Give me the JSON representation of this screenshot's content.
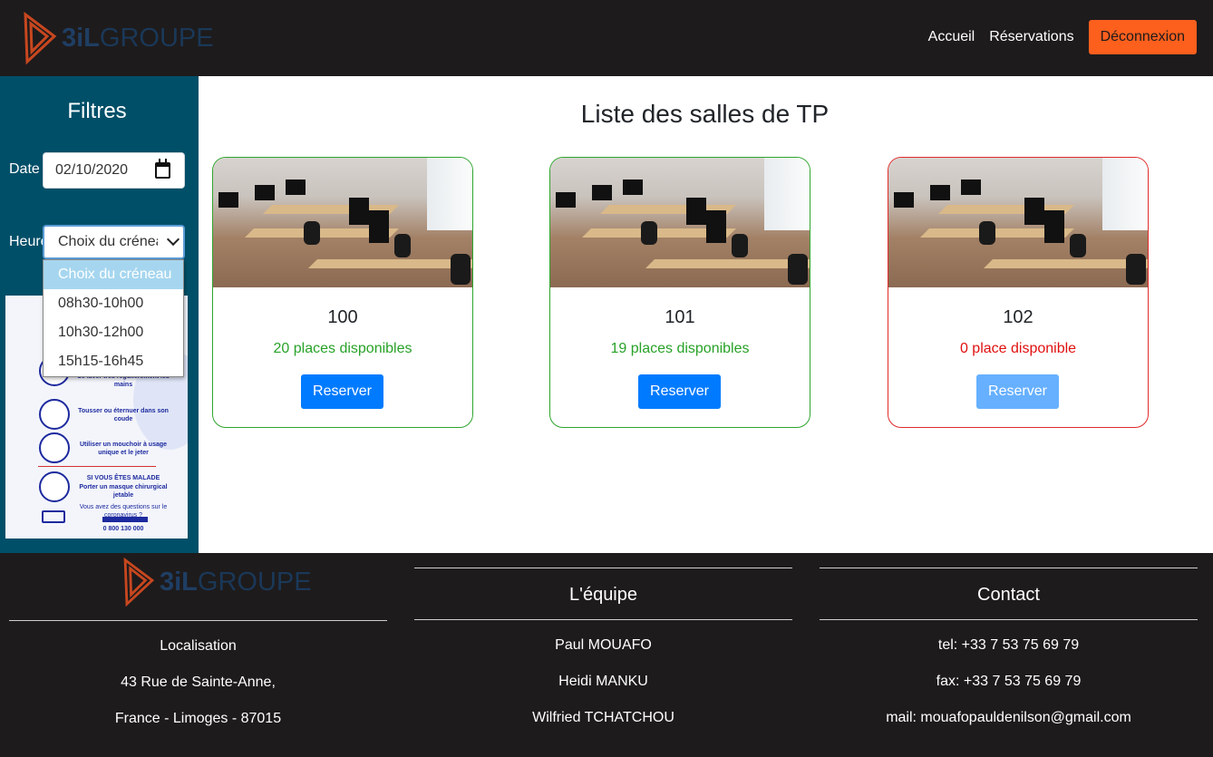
{
  "header": {
    "logo_brand": "3iL",
    "logo_group": "GROUPE",
    "nav": [
      "Accueil",
      "Réservations"
    ],
    "logout_label": "Déconnexion"
  },
  "sidebar": {
    "title": "Filtres",
    "date_label": "Date",
    "date_value": "02/10/2020",
    "time_label": "Heure",
    "select_value": "Choix du créneau",
    "options": [
      "Choix du créneau",
      "08h30-10h00",
      "10h30-12h00",
      "15h15-16h45"
    ],
    "poster_lines": [
      "Se laver très régulièrement les mains",
      "Tousser ou éternuer dans son coude",
      "Utiliser un mouchoir à usage unique et le jeter",
      "SI VOUS ÊTES MALADE",
      "Porter un masque chirurgical jetable",
      "Vous avez des questions sur le coronavirus ?",
      "0 800 130 000"
    ]
  },
  "main": {
    "title": "Liste des salles de TP",
    "rooms": [
      {
        "number": "100",
        "places": "20 places disponibles",
        "status": "available",
        "button": "Reserver"
      },
      {
        "number": "101",
        "places": "19 places disponibles",
        "status": "available",
        "button": "Reserver"
      },
      {
        "number": "102",
        "places": "0 place disponible",
        "status": "full",
        "button": "Reserver"
      }
    ]
  },
  "footer": {
    "logo_brand": "3iL",
    "logo_group": "GROUPE",
    "location": [
      "Localisation",
      "43 Rue de Sainte-Anne,",
      "France - Limoges - 87015"
    ],
    "team_title": "L'équipe",
    "team": [
      "Paul MOUAFO",
      "Heidi MANKU",
      "Wilfried TCHATCHOU"
    ],
    "contact_title": "Contact",
    "contact": [
      "tel: +33 7 53 75 69 79",
      "fax: +33 7 53 75 69 79",
      "mail: mouafopauldenilson@gmail.com"
    ]
  },
  "colors": {
    "dark_bg": "#1e1b1c",
    "sidebar_bg": "#004f68",
    "accent_orange": "#fd5f1d",
    "primary_blue": "#007bff",
    "available_green": "#28a228",
    "full_red": "#e01010"
  }
}
